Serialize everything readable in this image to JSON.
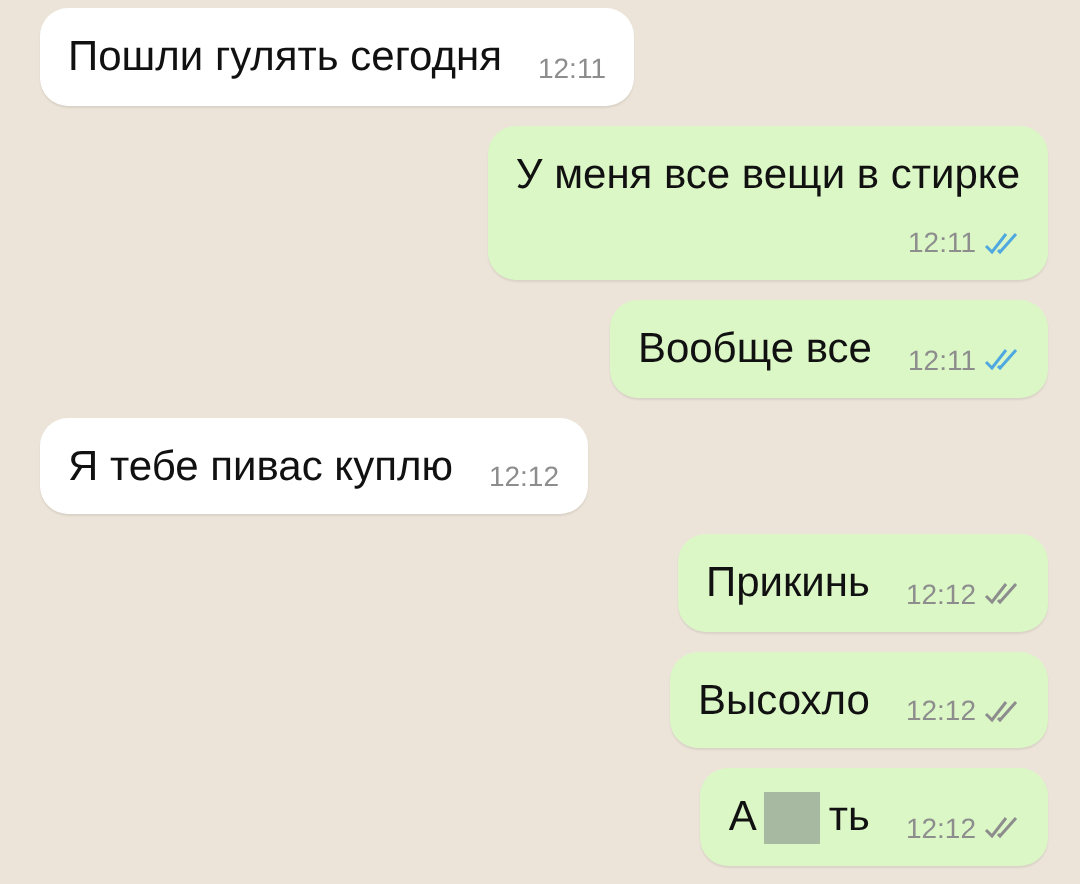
{
  "messages": [
    {
      "kind": "received",
      "text": "Пошли гулять сегодня",
      "time": "12:11",
      "time_below": false
    },
    {
      "kind": "sent",
      "text": "У меня все вещи в стирке",
      "time": "12:11",
      "read": true,
      "time_below": true
    },
    {
      "kind": "sent",
      "text": "Вообще все",
      "time": "12:11",
      "read": true,
      "time_below": false
    },
    {
      "kind": "received",
      "text": "Я тебе пивас куплю",
      "time": "12:12",
      "time_below": false
    },
    {
      "kind": "sent",
      "text": "Прикинь",
      "time": "12:12",
      "read": false,
      "time_below": false
    },
    {
      "kind": "sent",
      "text": "Высохло",
      "time": "12:12",
      "read": false,
      "time_below": false
    },
    {
      "kind": "censored",
      "text_before": "А",
      "text_after": "ть",
      "time": "12:12",
      "read": false,
      "time_below": false
    }
  ]
}
